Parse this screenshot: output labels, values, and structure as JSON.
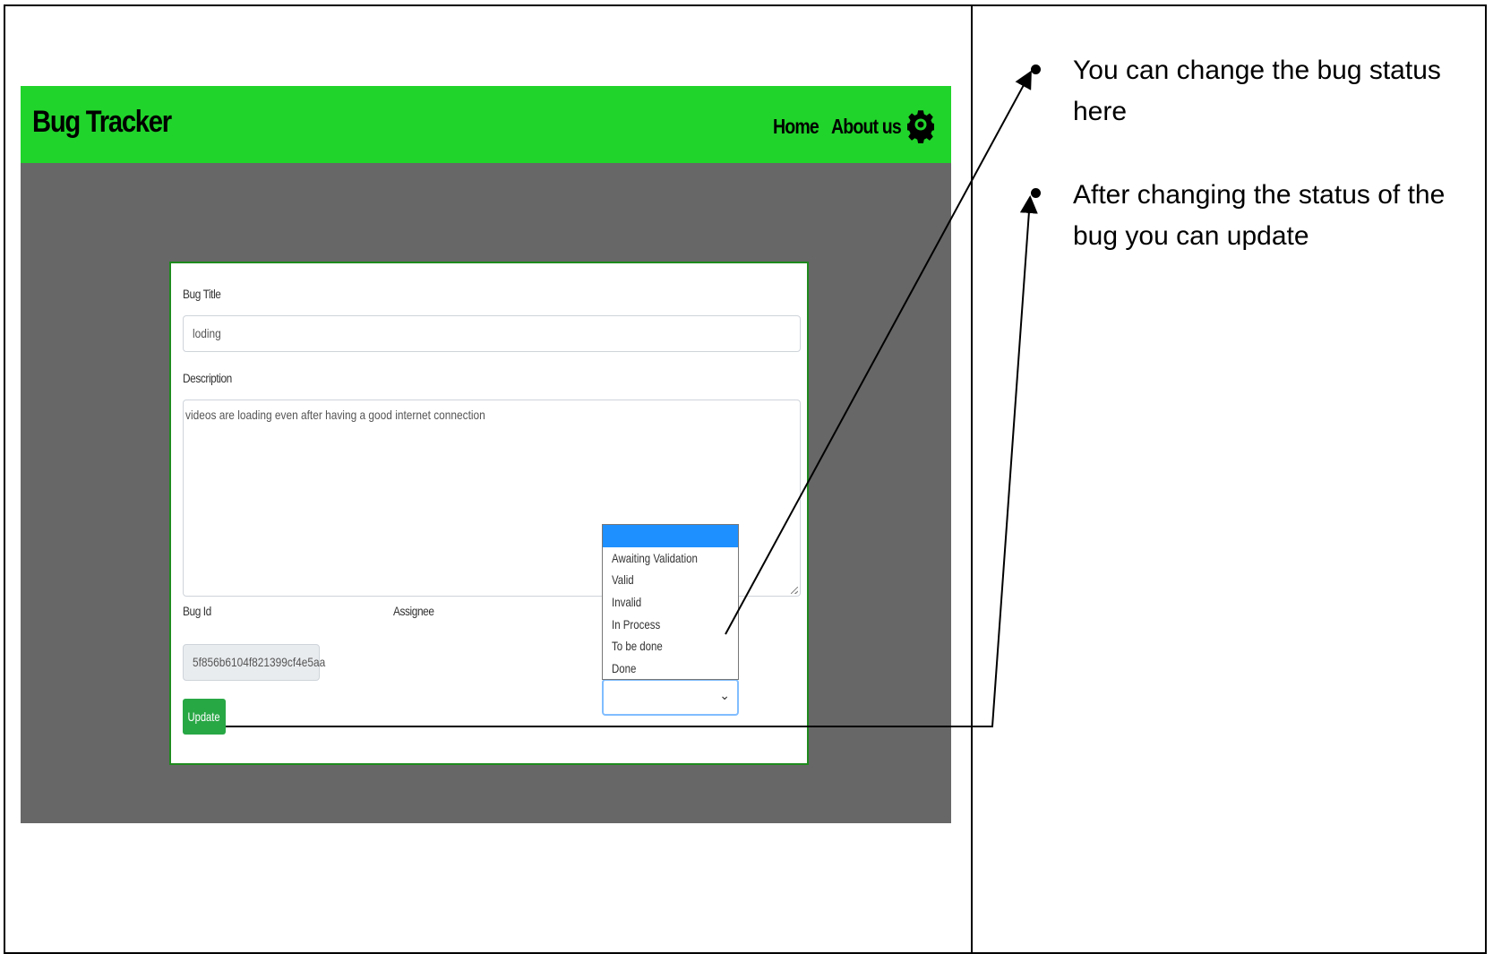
{
  "app": {
    "brand": "Bug Tracker",
    "nav": {
      "home": "Home",
      "about": "About us"
    },
    "accent_color": "#21d42b",
    "icons": {
      "settings": "gear-icon"
    }
  },
  "form": {
    "title_label": "Bug Title",
    "title_value": "loding",
    "description_label": "Description",
    "description_value": "videos are loading even after having a good internet connection",
    "bug_id_label": "Bug Id",
    "bug_id_value": "5f856b6104f821399cf4e5aa",
    "assignee_label": "Assignee",
    "status_options": [
      "",
      "Awaiting Validation",
      "Valid",
      "Invalid",
      "In Process",
      "To be done",
      "Done"
    ],
    "status_selected": "",
    "update_label": "Update"
  },
  "notes": {
    "note1": "You can change the bug status here",
    "note2": "After changing the status of the bug you can update"
  }
}
